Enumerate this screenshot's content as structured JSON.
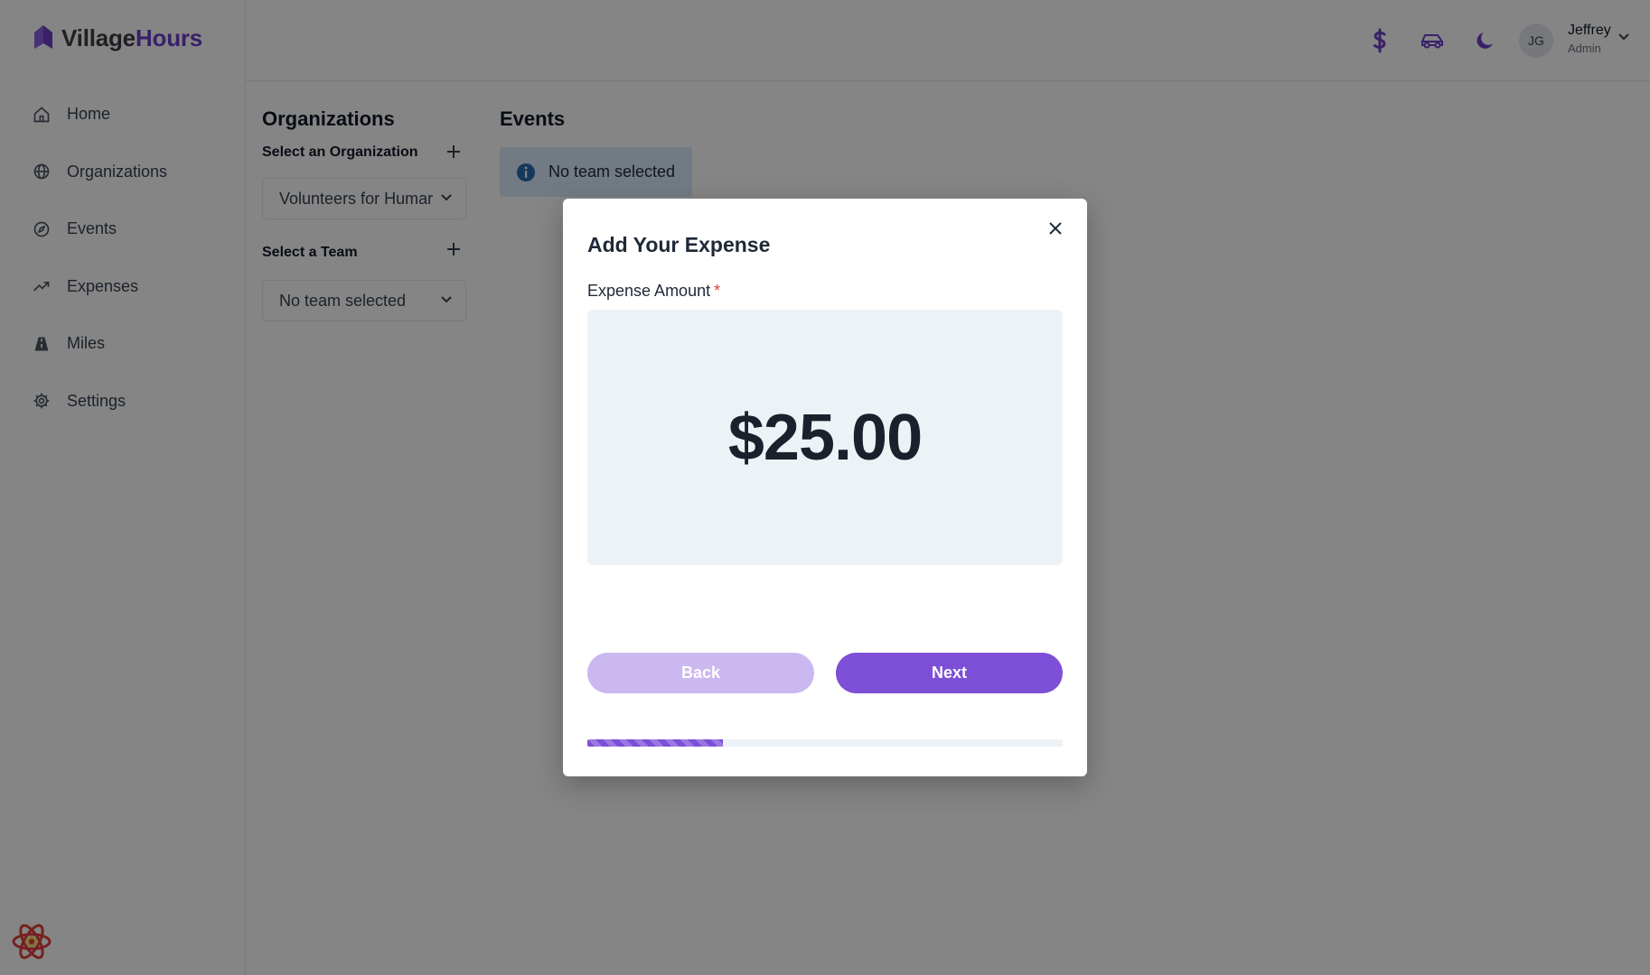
{
  "app": {
    "logo_part1": "Village",
    "logo_part2": "Hours",
    "brand_color": "#6d3fc9"
  },
  "sidebar": {
    "items": [
      {
        "label": "Home",
        "icon": "home-icon"
      },
      {
        "label": "Organizations",
        "icon": "globe-icon"
      },
      {
        "label": "Events",
        "icon": "compass-icon"
      },
      {
        "label": "Expenses",
        "icon": "trending-up-icon"
      },
      {
        "label": "Miles",
        "icon": "road-icon"
      },
      {
        "label": "Settings",
        "icon": "gear-icon"
      }
    ]
  },
  "header": {
    "icons": [
      "dollar-icon",
      "car-icon",
      "moon-icon"
    ],
    "avatar_initials": "JG",
    "user_name": "Jeffrey",
    "user_role": "Admin"
  },
  "organizations": {
    "title": "Organizations",
    "select_org_label": "Select an Organization",
    "selected_org": "Volunteers for Humar",
    "select_team_label": "Select a Team",
    "selected_team": "No team selected"
  },
  "events": {
    "title": "Events",
    "alert_text": "No team selected"
  },
  "modal": {
    "title": "Add Your Expense",
    "amount_label": "Expense Amount",
    "required_mark": "*",
    "amount_value": "$25.00",
    "back_label": "Back",
    "next_label": "Next",
    "progress_fraction": 0.286
  }
}
